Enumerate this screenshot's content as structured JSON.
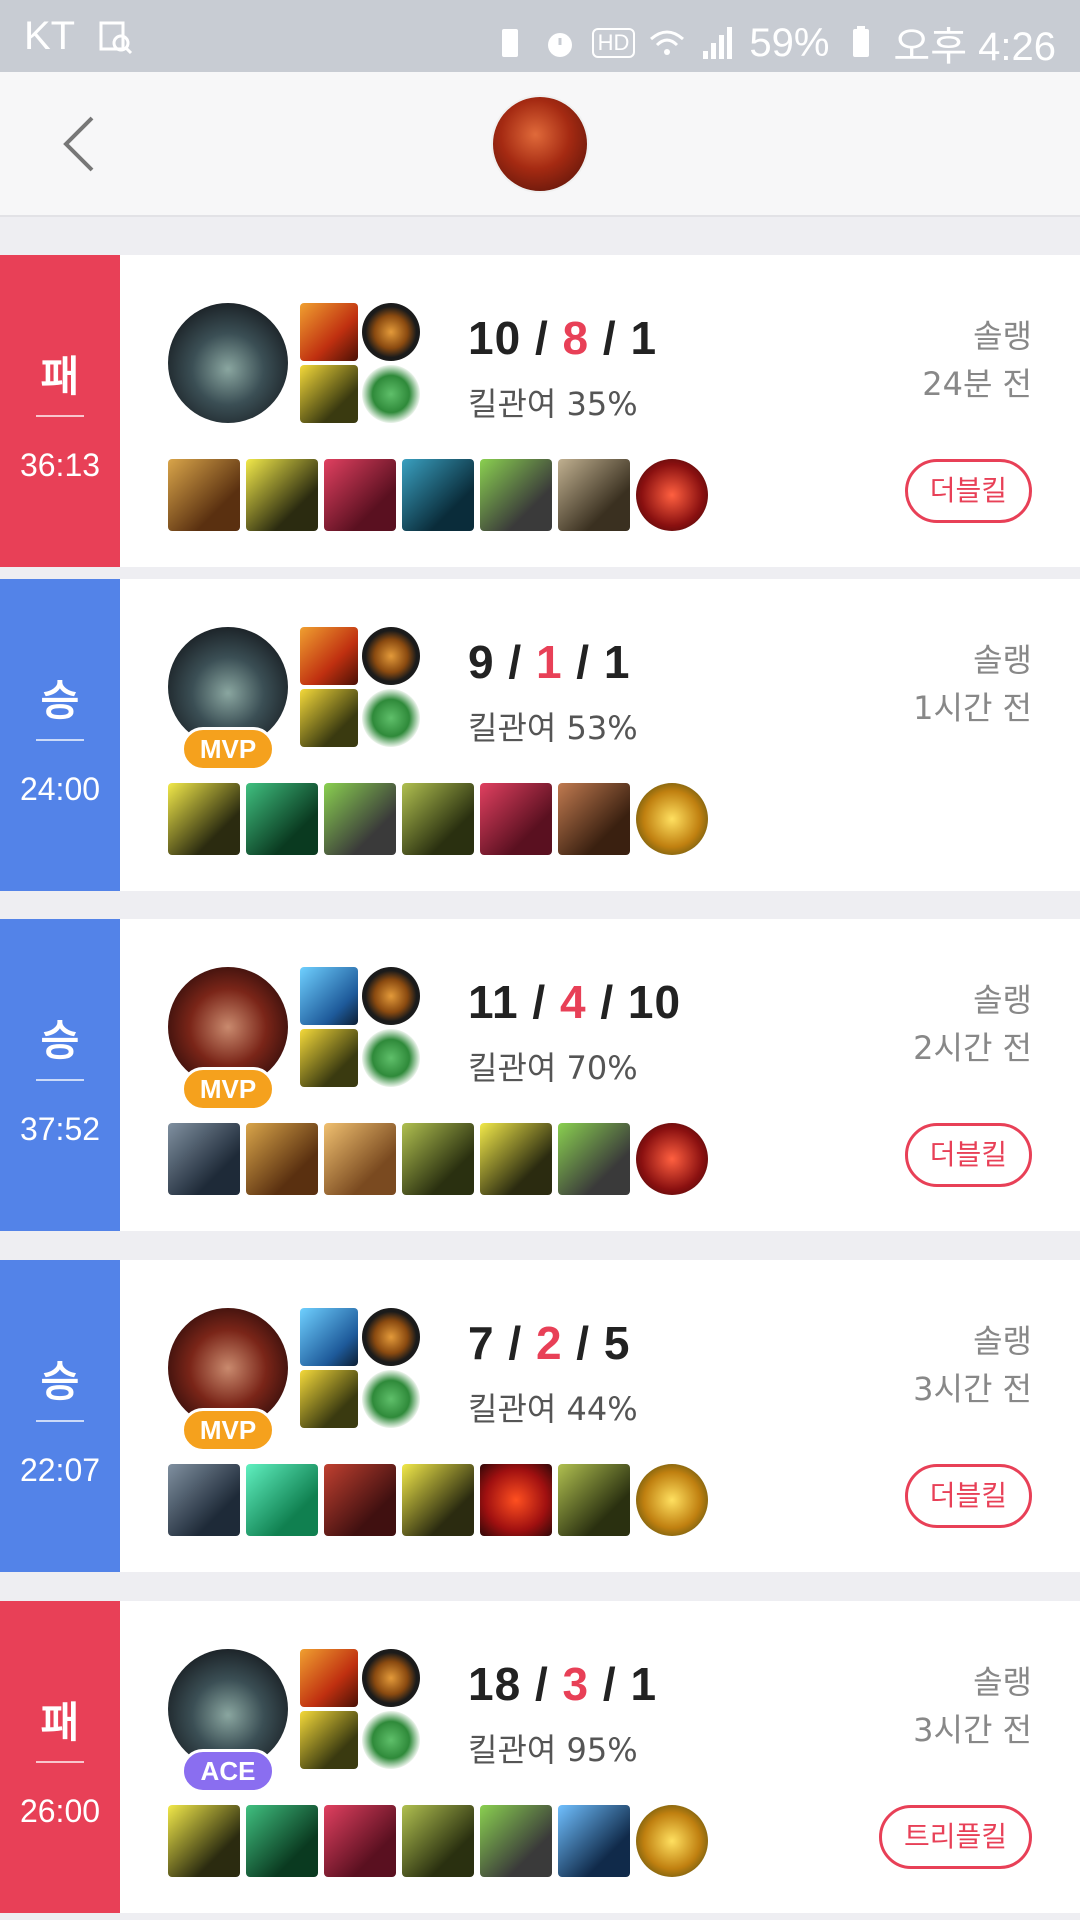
{
  "status_bar": {
    "carrier": "KT",
    "battery": "59%",
    "time": "오후 4:26",
    "hd_label": "HD",
    "icons": [
      "monitor-icon",
      "battery-saver-icon",
      "alarm-icon",
      "hd-icon",
      "wifi-icon",
      "signal-icon",
      "battery-icon"
    ]
  },
  "header": {
    "back_icon": "chevron-left-icon",
    "logo": "champion-logo"
  },
  "colors": {
    "loss": "#e84057",
    "win": "#5383e8",
    "mvp": "#f5a11d",
    "ace": "#8a6ef0",
    "deaths": "#e84057"
  },
  "matches": [
    {
      "result": "패",
      "duration": "36:13",
      "badge": "",
      "kills": "10",
      "deaths": "8",
      "assists": "1",
      "kill_participation": "킬관여 35%",
      "queue": "솔랭",
      "time_ago": "24분 전",
      "multikill": "더블킬"
    },
    {
      "result": "승",
      "duration": "24:00",
      "badge": "MVP",
      "kills": "9",
      "deaths": "1",
      "assists": "1",
      "kill_participation": "킬관여 53%",
      "queue": "솔랭",
      "time_ago": "1시간 전",
      "multikill": ""
    },
    {
      "result": "승",
      "duration": "37:52",
      "badge": "MVP",
      "kills": "11",
      "deaths": "4",
      "assists": "10",
      "kill_participation": "킬관여 70%",
      "queue": "솔랭",
      "time_ago": "2시간 전",
      "multikill": "더블킬"
    },
    {
      "result": "승",
      "duration": "22:07",
      "badge": "MVP",
      "kills": "7",
      "deaths": "2",
      "assists": "5",
      "kill_participation": "킬관여 44%",
      "queue": "솔랭",
      "time_ago": "3시간 전",
      "multikill": "더블킬"
    },
    {
      "result": "패",
      "duration": "26:00",
      "badge": "ACE",
      "kills": "18",
      "deaths": "3",
      "assists": "1",
      "kill_participation": "킬관여 95%",
      "queue": "솔랭",
      "time_ago": "3시간 전",
      "multikill": "트리플킬"
    }
  ]
}
